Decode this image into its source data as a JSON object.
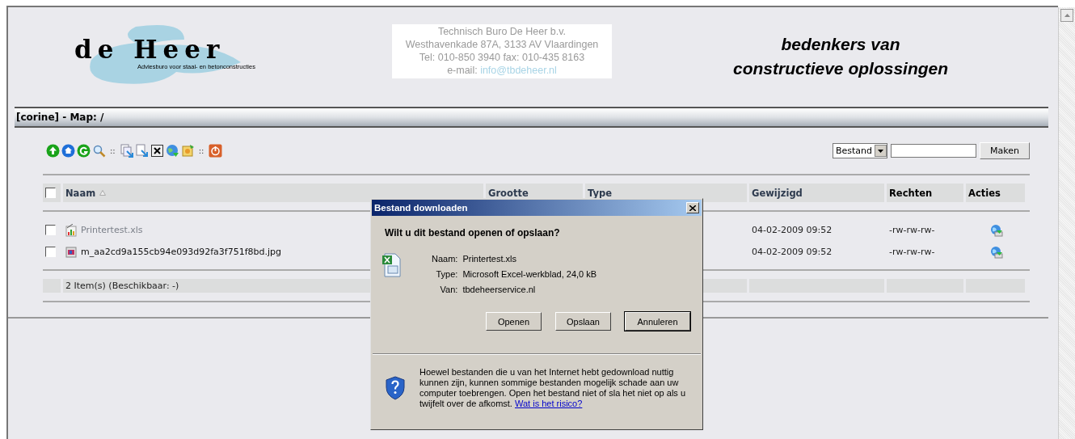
{
  "header": {
    "logo": {
      "name": "de Heer",
      "tagline": "Adviesburo voor staal- en betonconstructies"
    },
    "address": {
      "lines": [
        "Technisch Buro De Heer b.v.",
        "Westhavenkade 87A, 3133 AV  Vlaardingen",
        "Tel: 010-850 3940   fax: 010-435 8163"
      ],
      "email_label": "e-mail:",
      "email": "info@tbdeheer.nl"
    },
    "slogan": [
      "bedenkers van",
      "constructieve oplossingen"
    ]
  },
  "title_bar": "[corine] - Map: /",
  "toolbar": {
    "items": [
      {
        "kind": "button"
      },
      {
        "kind": "button"
      },
      {
        "kind": "button"
      },
      {
        "kind": "button"
      },
      {
        "kind": "separator",
        "label": "::"
      },
      {
        "kind": "button"
      },
      {
        "kind": "button"
      },
      {
        "kind": "button"
      },
      {
        "kind": "button"
      },
      {
        "kind": "button"
      },
      {
        "kind": "separator",
        "label": "::"
      },
      {
        "kind": "button"
      }
    ]
  },
  "create": {
    "type_select": "Bestand",
    "button": "Maken"
  },
  "table": {
    "select_all": {
      "checked": false
    },
    "columns": [
      {
        "label": "Naam",
        "sortable": true,
        "sorted": true
      },
      {
        "label": "Grootte",
        "sortable": true,
        "sorted": false
      },
      {
        "label": "Type",
        "sortable": true,
        "sorted": false
      },
      {
        "label": "Gewijzigd",
        "sortable": true,
        "sorted": false
      },
      {
        "label": "Rechten",
        "sortable": false,
        "sorted": false
      },
      {
        "label": "Acties",
        "sortable": false,
        "sorted": false
      }
    ],
    "rows": [
      {
        "checked": false,
        "kind": "spreadsheet",
        "name": "Printertest.xls",
        "visited": true,
        "modified": "04-02-2009 09:52",
        "rights": "-rw-rw-rw-"
      },
      {
        "checked": false,
        "kind": "image",
        "name": "m_aa2cd9a155cb94e093d92fa3f751f8bd.jpg",
        "visited": false,
        "modified": "04-02-2009 09:52",
        "rights": "-rw-rw-rw-"
      }
    ],
    "footer": "2 Item(s) (Beschikbaar: -)"
  },
  "dialog": {
    "title": "Bestand downloaden",
    "question": "Wilt u dit bestand openen of opslaan?",
    "fields": [
      {
        "label": "Naam:",
        "value": "Printertest.xls"
      },
      {
        "label": "Type:",
        "value": "Microsoft Excel-werkblad, 24,0 kB"
      },
      {
        "label": "Van:",
        "value": "tbdeheerservice.nl"
      }
    ],
    "buttons": [
      {
        "label": "Openen",
        "default": false
      },
      {
        "label": "Opslaan",
        "default": false
      },
      {
        "label": "Annuleren",
        "default": true
      }
    ],
    "warning": "Hoewel bestanden die u van het Internet hebt gedownload nuttig kunnen zijn, kunnen sommige bestanden mogelijk schade aan uw computer toebrengen. Open het bestand niet of sla het niet op als u twijfelt over de afkomst.",
    "risk_link": "Wat is het risico?"
  }
}
